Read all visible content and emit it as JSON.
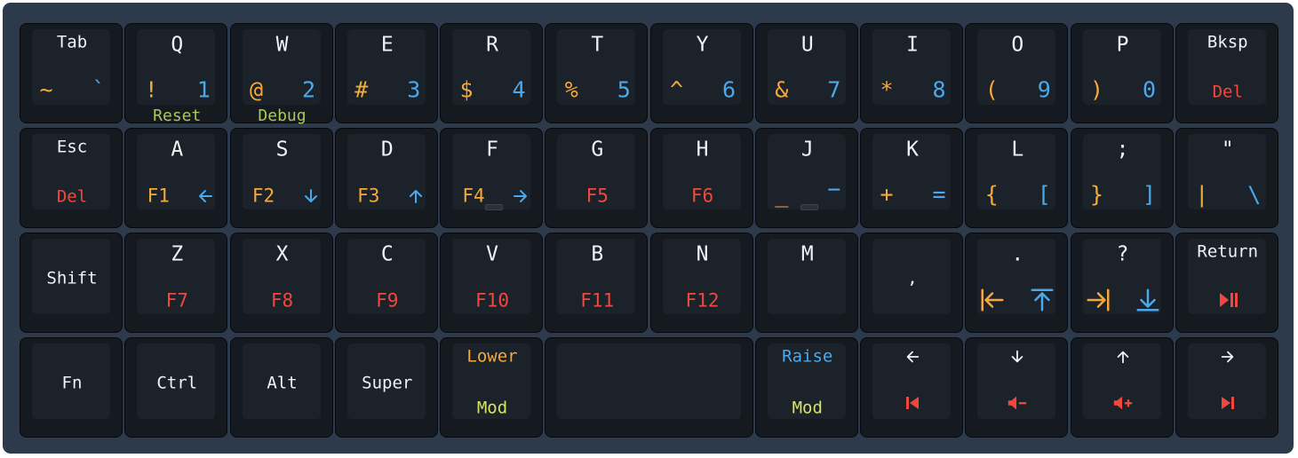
{
  "colors": {
    "frame": "#2c3a4b",
    "key": "#151a21",
    "cap": "#1c222a",
    "white": "#f0f2f5",
    "orange": "#f6a93b",
    "blue": "#4aa9ec",
    "red": "#f0483e",
    "green": "#a9c85a",
    "yellow": "#d6e26a"
  },
  "rows": [
    [
      {
        "id": "tab",
        "top": "Tab",
        "left": "~",
        "left_color": "orange",
        "right": "`",
        "right_color": "blue"
      },
      {
        "id": "q",
        "top": "Q",
        "left": "!",
        "left_color": "orange",
        "right": "1",
        "right_color": "blue",
        "under": "Reset",
        "under_color": "green"
      },
      {
        "id": "w",
        "top": "W",
        "left": "@",
        "left_color": "orange",
        "right": "2",
        "right_color": "blue",
        "under": "Debug",
        "under_color": "green"
      },
      {
        "id": "e",
        "top": "E",
        "left": "#",
        "left_color": "orange",
        "right": "3",
        "right_color": "blue"
      },
      {
        "id": "r",
        "top": "R",
        "left": "$",
        "left_color": "orange",
        "right": "4",
        "right_color": "blue"
      },
      {
        "id": "t",
        "top": "T",
        "left": "%",
        "left_color": "orange",
        "right": "5",
        "right_color": "blue"
      },
      {
        "id": "y",
        "top": "Y",
        "left": "^",
        "left_color": "orange",
        "right": "6",
        "right_color": "blue"
      },
      {
        "id": "u",
        "top": "U",
        "left": "&",
        "left_color": "orange",
        "right": "7",
        "right_color": "blue"
      },
      {
        "id": "i",
        "top": "I",
        "left": "*",
        "left_color": "orange",
        "right": "8",
        "right_color": "blue"
      },
      {
        "id": "o",
        "top": "O",
        "left": "(",
        "left_color": "orange",
        "right": "9",
        "right_color": "blue"
      },
      {
        "id": "p",
        "top": "P",
        "left": ")",
        "left_color": "orange",
        "right": "0",
        "right_color": "blue"
      },
      {
        "id": "bksp",
        "top": "Bksp",
        "center": "Del",
        "center_color": "red"
      }
    ],
    [
      {
        "id": "esc",
        "top": "Esc",
        "center": "Del",
        "center_color": "red"
      },
      {
        "id": "a",
        "top": "A",
        "left": "F1",
        "left_color": "orange",
        "right_icon": "arrow-left-icon",
        "right_color": "blue"
      },
      {
        "id": "s",
        "top": "S",
        "left": "F2",
        "left_color": "orange",
        "right_icon": "arrow-down-icon",
        "right_color": "blue"
      },
      {
        "id": "d",
        "top": "D",
        "left": "F3",
        "left_color": "orange",
        "right_icon": "arrow-up-icon",
        "right_color": "blue"
      },
      {
        "id": "f",
        "top": "F",
        "left": "F4",
        "left_color": "orange",
        "right_icon": "arrow-right-icon",
        "right_color": "blue",
        "homing": true
      },
      {
        "id": "g",
        "top": "G",
        "center": "F5",
        "center_color": "red"
      },
      {
        "id": "h",
        "top": "H",
        "center": "F6",
        "center_color": "red"
      },
      {
        "id": "j",
        "top": "J",
        "left": "_",
        "left_color": "orange",
        "right": "−",
        "right_color": "blue",
        "homing": true
      },
      {
        "id": "k",
        "top": "K",
        "left": "+",
        "left_color": "orange",
        "right": "=",
        "right_color": "blue"
      },
      {
        "id": "l",
        "top": "L",
        "left": "{",
        "left_color": "orange",
        "right": "[",
        "right_color": "blue"
      },
      {
        "id": "semicolon",
        "top": ";",
        "left": "}",
        "left_color": "orange",
        "right": "]",
        "right_color": "blue"
      },
      {
        "id": "quote",
        "top": "\"",
        "left": "|",
        "left_color": "orange",
        "right": "\\",
        "right_color": "blue"
      }
    ],
    [
      {
        "id": "shift",
        "middle": "Shift"
      },
      {
        "id": "z",
        "top": "Z",
        "center": "F7",
        "center_color": "red"
      },
      {
        "id": "x",
        "top": "X",
        "center": "F8",
        "center_color": "red"
      },
      {
        "id": "c",
        "top": "C",
        "center": "F9",
        "center_color": "red"
      },
      {
        "id": "v",
        "top": "V",
        "center": "F10",
        "center_color": "red"
      },
      {
        "id": "b",
        "top": "B",
        "center": "F11",
        "center_color": "red"
      },
      {
        "id": "n",
        "top": "N",
        "center": "F12",
        "center_color": "red"
      },
      {
        "id": "m",
        "top": "M"
      },
      {
        "id": "comma",
        "middle": ","
      },
      {
        "id": "period",
        "top": ".",
        "left_icon": "home-icon",
        "left_color": "orange",
        "right_icon": "page-up-icon",
        "right_color": "blue"
      },
      {
        "id": "question",
        "top": "?",
        "left_icon": "end-icon",
        "left_color": "orange",
        "right_icon": "page-down-icon",
        "right_color": "blue"
      },
      {
        "id": "return",
        "top": "Return",
        "center_icon": "play-pause-icon",
        "center_color": "red"
      }
    ],
    [
      {
        "id": "fn",
        "middle": "Fn"
      },
      {
        "id": "ctrl",
        "middle": "Ctrl"
      },
      {
        "id": "alt",
        "middle": "Alt"
      },
      {
        "id": "super",
        "middle": "Super"
      },
      {
        "id": "lower",
        "top": "Lower",
        "top_color": "orange",
        "center": "Mod",
        "center_color": "yellow"
      },
      {
        "id": "space",
        "span": 2
      },
      {
        "id": "raise",
        "top": "Raise",
        "top_color": "blue",
        "center": "Mod",
        "center_color": "yellow"
      },
      {
        "id": "left",
        "top_icon": "arrow-left-icon",
        "center_icon": "previous-track-icon",
        "center_color": "red"
      },
      {
        "id": "down",
        "top_icon": "arrow-down-icon",
        "center_icon": "volume-down-icon",
        "center_color": "red"
      },
      {
        "id": "up",
        "top_icon": "arrow-up-icon",
        "center_icon": "volume-up-icon",
        "center_color": "red"
      },
      {
        "id": "right",
        "top_icon": "arrow-right-icon",
        "center_icon": "next-track-icon",
        "center_color": "red"
      }
    ]
  ]
}
